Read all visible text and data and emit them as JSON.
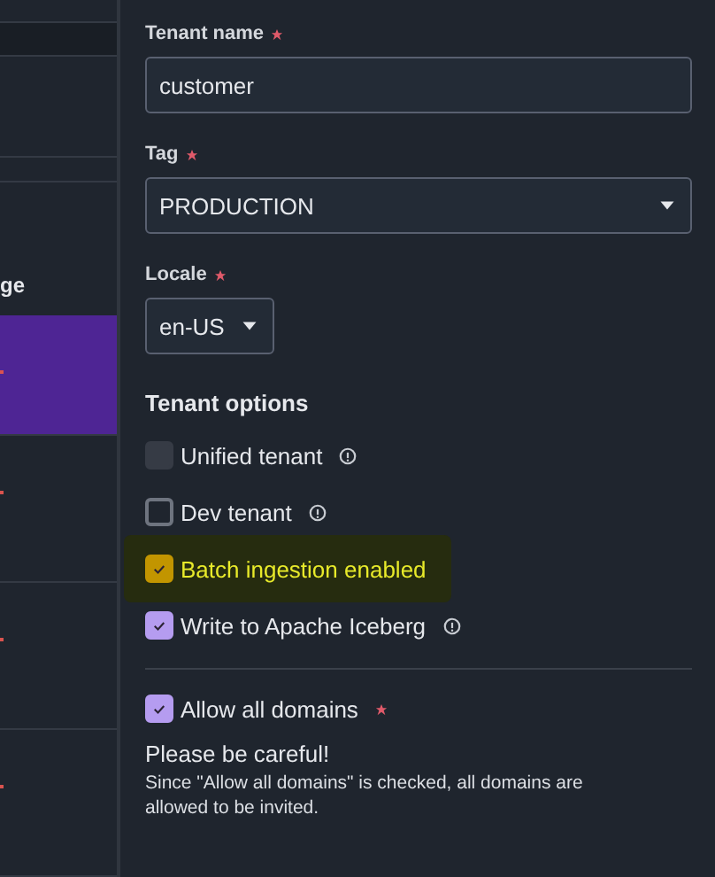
{
  "side_table": {
    "header": "ge",
    "rows": [
      {
        "selected": true,
        "flagged": true
      },
      {
        "selected": false,
        "flagged": true
      },
      {
        "selected": false,
        "flagged": true
      },
      {
        "selected": false,
        "flagged": true
      }
    ]
  },
  "form": {
    "fields": [
      {
        "kind": "text",
        "label": "Tenant name",
        "required": true,
        "value": "customer"
      },
      {
        "kind": "select",
        "label": "Tag",
        "required": true,
        "value": "PRODUCTION",
        "wide": true
      },
      {
        "kind": "select",
        "label": "Locale",
        "required": true,
        "value": "en-US",
        "wide": false
      }
    ],
    "options_title": "Tenant options",
    "options": [
      {
        "label": "Unified tenant",
        "checked": false,
        "disabled": true,
        "info": true,
        "highlighted": false
      },
      {
        "label": "Dev tenant",
        "checked": false,
        "disabled": false,
        "info": true,
        "highlighted": false
      },
      {
        "label": "Batch ingestion enabled",
        "checked": true,
        "disabled": false,
        "info": false,
        "highlighted": true
      },
      {
        "label": "Write to Apache Iceberg",
        "checked": true,
        "disabled": false,
        "info": true,
        "highlighted": false
      }
    ],
    "domains": {
      "label": "Allow all domains",
      "checked": true,
      "required": true,
      "warning_title": "Please be careful!",
      "warning_text": "Since \"Allow all domains\" is checked, all domains are allowed to be invited."
    }
  }
}
